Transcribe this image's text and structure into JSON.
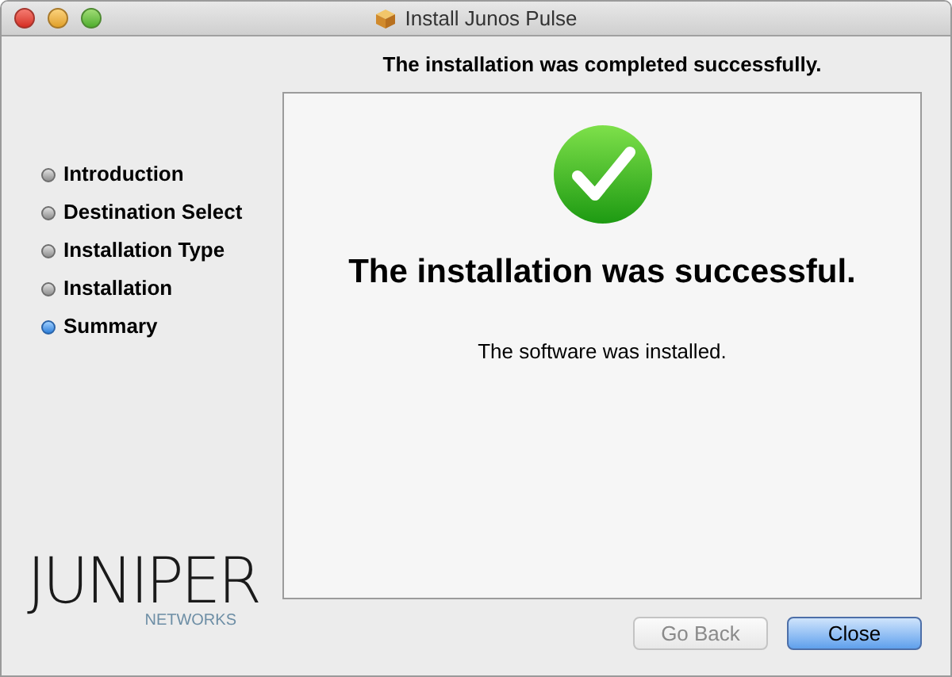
{
  "window": {
    "title": "Install Junos Pulse"
  },
  "header": "The installation was completed successfully.",
  "steps": [
    {
      "label": "Introduction",
      "selected": false
    },
    {
      "label": "Destination Select",
      "selected": false
    },
    {
      "label": "Installation Type",
      "selected": false
    },
    {
      "label": "Installation",
      "selected": false
    },
    {
      "label": "Summary",
      "selected": true
    }
  ],
  "logo": {
    "wordmark": "JUNIPER",
    "tagline": "NETWORKS"
  },
  "content": {
    "heading": "The installation was successful.",
    "message": "The software was installed."
  },
  "buttons": [
    {
      "label": "Go Back",
      "disabled": true,
      "default": false
    },
    {
      "label": "Close",
      "disabled": false,
      "default": true
    }
  ]
}
